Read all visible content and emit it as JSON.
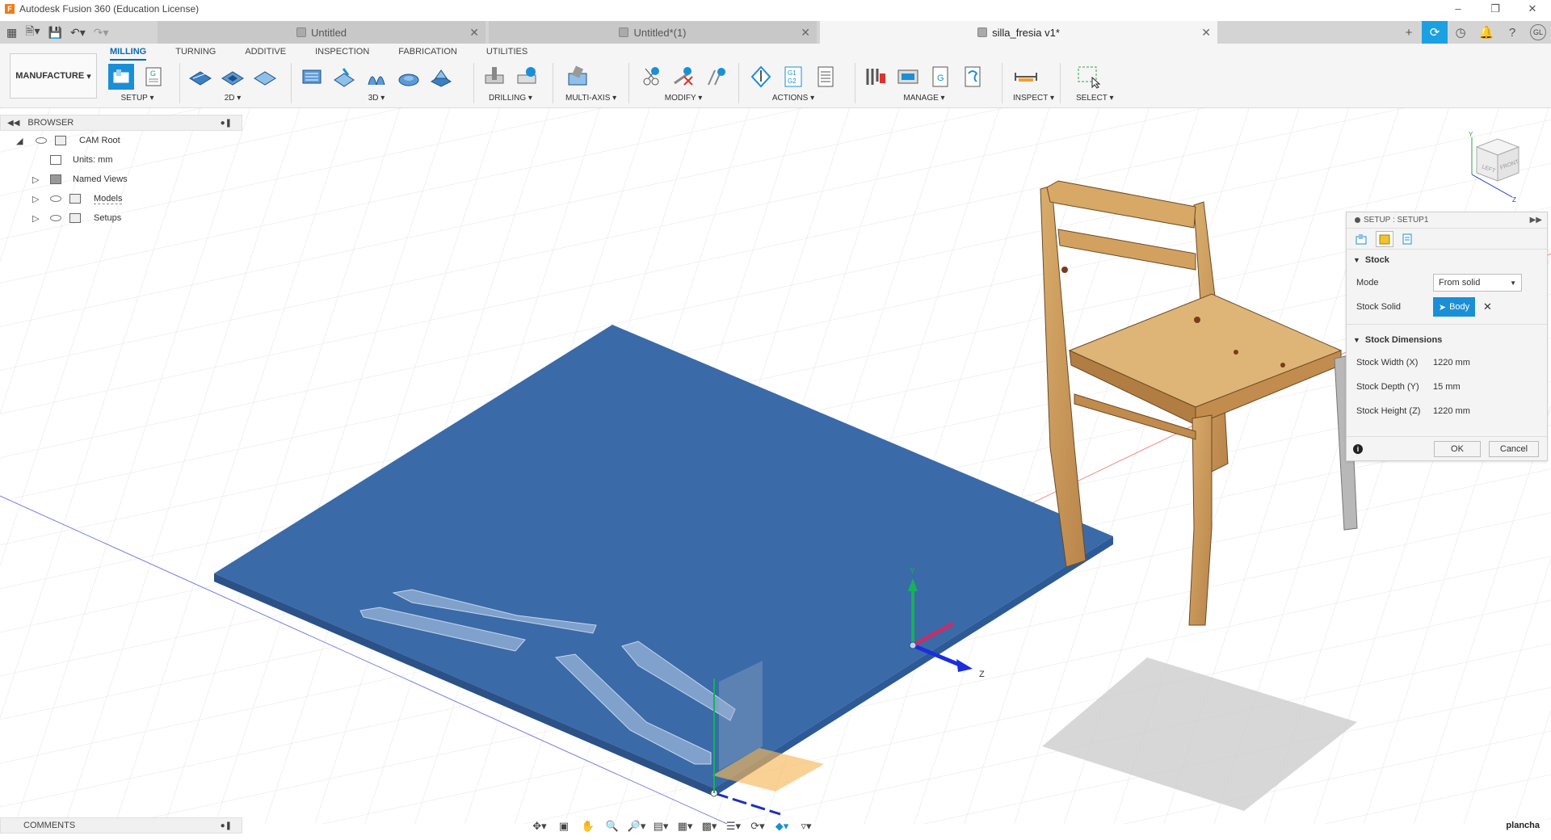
{
  "window": {
    "title": "Autodesk Fusion 360 (Education License)",
    "logo_letter": "F"
  },
  "tabs": [
    {
      "label": "Untitled"
    },
    {
      "label": "Untitled*(1)"
    },
    {
      "label": "silla_fresia v1*"
    }
  ],
  "user": {
    "initials": "GL"
  },
  "ribbon": {
    "workspace": "MANUFACTURE",
    "tabs": [
      "MILLING",
      "TURNING",
      "ADDITIVE",
      "INSPECTION",
      "FABRICATION",
      "UTILITIES"
    ],
    "groups": {
      "setup": "SETUP",
      "g2d": "2D",
      "g3d": "3D",
      "drilling": "DRILLING",
      "multiaxis": "MULTI-AXIS",
      "modify": "MODIFY",
      "actions": "ACTIONS",
      "manage": "MANAGE",
      "inspect": "INSPECT",
      "select": "SELECT"
    }
  },
  "browser": {
    "title": "BROWSER",
    "items": [
      {
        "label": "CAM Root"
      },
      {
        "label": "Units: mm"
      },
      {
        "label": "Named Views"
      },
      {
        "label": "Models"
      },
      {
        "label": "Setups"
      }
    ]
  },
  "setup_panel": {
    "title": "SETUP : SETUP1",
    "stock_section": "Stock",
    "mode_label": "Mode",
    "mode_value": "From solid",
    "stock_solid_label": "Stock Solid",
    "stock_solid_value": "Body",
    "dimensions_section": "Stock Dimensions",
    "width_label": "Stock Width (X)",
    "width_value": "1220 mm",
    "depth_label": "Stock Depth (Y)",
    "depth_value": "15 mm",
    "height_label": "Stock Height (Z)",
    "height_value": "1220 mm",
    "ok": "OK",
    "cancel": "Cancel"
  },
  "viewcube": {
    "left": "LEFT",
    "front": "FRONT",
    "y_axis": "Y",
    "z_axis": "Z"
  },
  "triad": {
    "y_label": "Y",
    "z_label": "Z"
  },
  "comments": {
    "title": "COMMENTS"
  },
  "status": {
    "selection_name": "plancha"
  },
  "colors": {
    "accent": "#1a8fd6",
    "stock_blue": "#3a6aa8",
    "wood": "#c99a5a"
  }
}
